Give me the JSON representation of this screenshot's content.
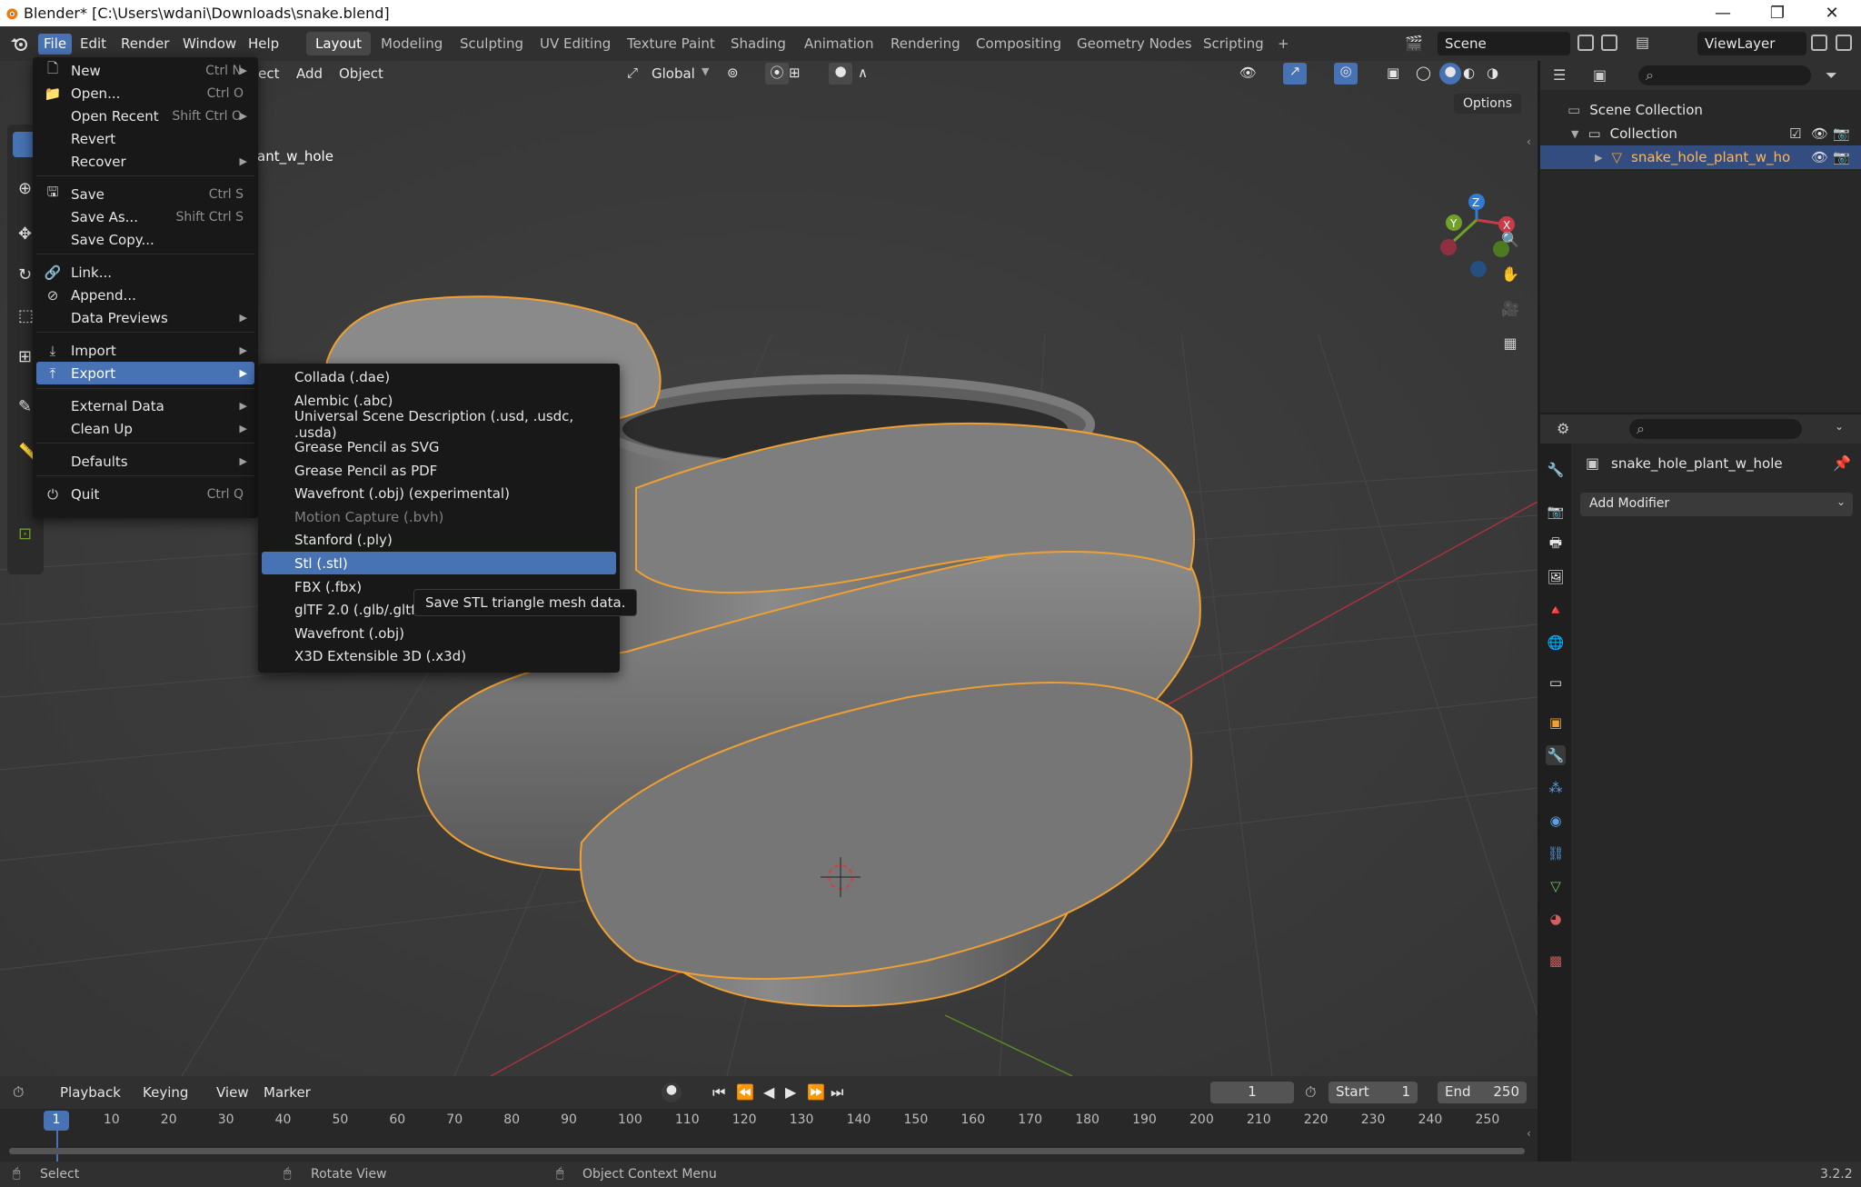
{
  "window": {
    "title": "Blender* [C:\\Users\\wdani\\Downloads\\snake.blend]",
    "minimize": "—",
    "maximize": "❐",
    "close": "✕"
  },
  "topmenu": [
    "File",
    "Edit",
    "Render",
    "Window",
    "Help"
  ],
  "workspaces": [
    "Layout",
    "Modeling",
    "Sculpting",
    "UV Editing",
    "Texture Paint",
    "Shading",
    "Animation",
    "Rendering",
    "Compositing",
    "Geometry Nodes",
    "Scripting",
    "+"
  ],
  "scene": "Scene",
  "view_layer": "ViewLayer",
  "viewport": {
    "header_items": [
      "ject",
      "Add",
      "Object"
    ],
    "transform": "Global",
    "options": "Options",
    "object_name_partial": "ant_w_hole",
    "gizmo": {
      "x": "X",
      "y": "Y",
      "z": "Z"
    }
  },
  "file_menu": [
    {
      "label": "New",
      "shortcut": "Ctrl N",
      "arrow": true,
      "icon": "new-file-icon"
    },
    {
      "label": "Open...",
      "shortcut": "Ctrl O",
      "icon": "folder-icon"
    },
    {
      "label": "Open Recent",
      "shortcut": "Shift Ctrl O",
      "arrow": true
    },
    {
      "label": "Revert"
    },
    {
      "label": "Recover",
      "arrow": true
    },
    {
      "label": "Save",
      "shortcut": "Ctrl S",
      "icon": "save-icon"
    },
    {
      "label": "Save As...",
      "shortcut": "Shift Ctrl S"
    },
    {
      "label": "Save Copy..."
    },
    {
      "label": "Link...",
      "icon": "link-icon"
    },
    {
      "label": "Append...",
      "icon": "append-icon"
    },
    {
      "label": "Data Previews",
      "arrow": true
    },
    {
      "label": "Import",
      "arrow": true,
      "icon": "import-icon"
    },
    {
      "label": "Export",
      "arrow": true,
      "icon": "export-icon",
      "highlighted": true
    },
    {
      "label": "External Data",
      "arrow": true
    },
    {
      "label": "Clean Up",
      "arrow": true
    },
    {
      "label": "Defaults",
      "arrow": true
    },
    {
      "label": "Quit",
      "shortcut": "Ctrl Q",
      "icon": "power-icon"
    }
  ],
  "export_menu": [
    {
      "label": "Collada (.dae)"
    },
    {
      "label": "Alembic (.abc)"
    },
    {
      "label": "Universal Scene Description (.usd, .usdc, .usda)"
    },
    {
      "label": "Grease Pencil as SVG"
    },
    {
      "label": "Grease Pencil as PDF"
    },
    {
      "label": "Wavefront (.obj) (experimental)"
    },
    {
      "label": "Motion Capture (.bvh)",
      "disabled": true
    },
    {
      "label": "Stanford (.ply)"
    },
    {
      "label": "Stl (.stl)",
      "highlighted": true
    },
    {
      "label": "FBX (.fbx)"
    },
    {
      "label": "glTF 2.0 (.glb/.gltf)"
    },
    {
      "label": "Wavefront (.obj)"
    },
    {
      "label": "X3D Extensible 3D (.x3d)"
    }
  ],
  "tooltip": "Save STL triangle mesh data.",
  "outliner": {
    "scene_collection": "Scene Collection",
    "collection": "Collection",
    "object": "snake_hole_plant_w_ho"
  },
  "properties": {
    "object_name": "snake_hole_plant_w_hole",
    "add_modifier": "Add Modifier"
  },
  "timeline": {
    "menus": [
      "Playback",
      "Keying",
      "View",
      "Marker"
    ],
    "current_frame": "1",
    "start_label": "Start",
    "start": "1",
    "end_label": "End",
    "end": "250",
    "ticks": [
      "1",
      "10",
      "20",
      "30",
      "40",
      "50",
      "60",
      "70",
      "80",
      "90",
      "100",
      "110",
      "120",
      "130",
      "140",
      "150",
      "160",
      "170",
      "180",
      "190",
      "200",
      "210",
      "220",
      "230",
      "240",
      "250"
    ]
  },
  "statusbar": {
    "select": "Select",
    "rotate": "Rotate View",
    "context": "Object Context Menu",
    "version": "3.2.2"
  },
  "colors": {
    "accent": "#4772b3",
    "selection_outline": "#f0a030",
    "x_axis": "#c83c4a",
    "y_axis": "#6ea02a",
    "z_axis": "#2f7bd6"
  }
}
